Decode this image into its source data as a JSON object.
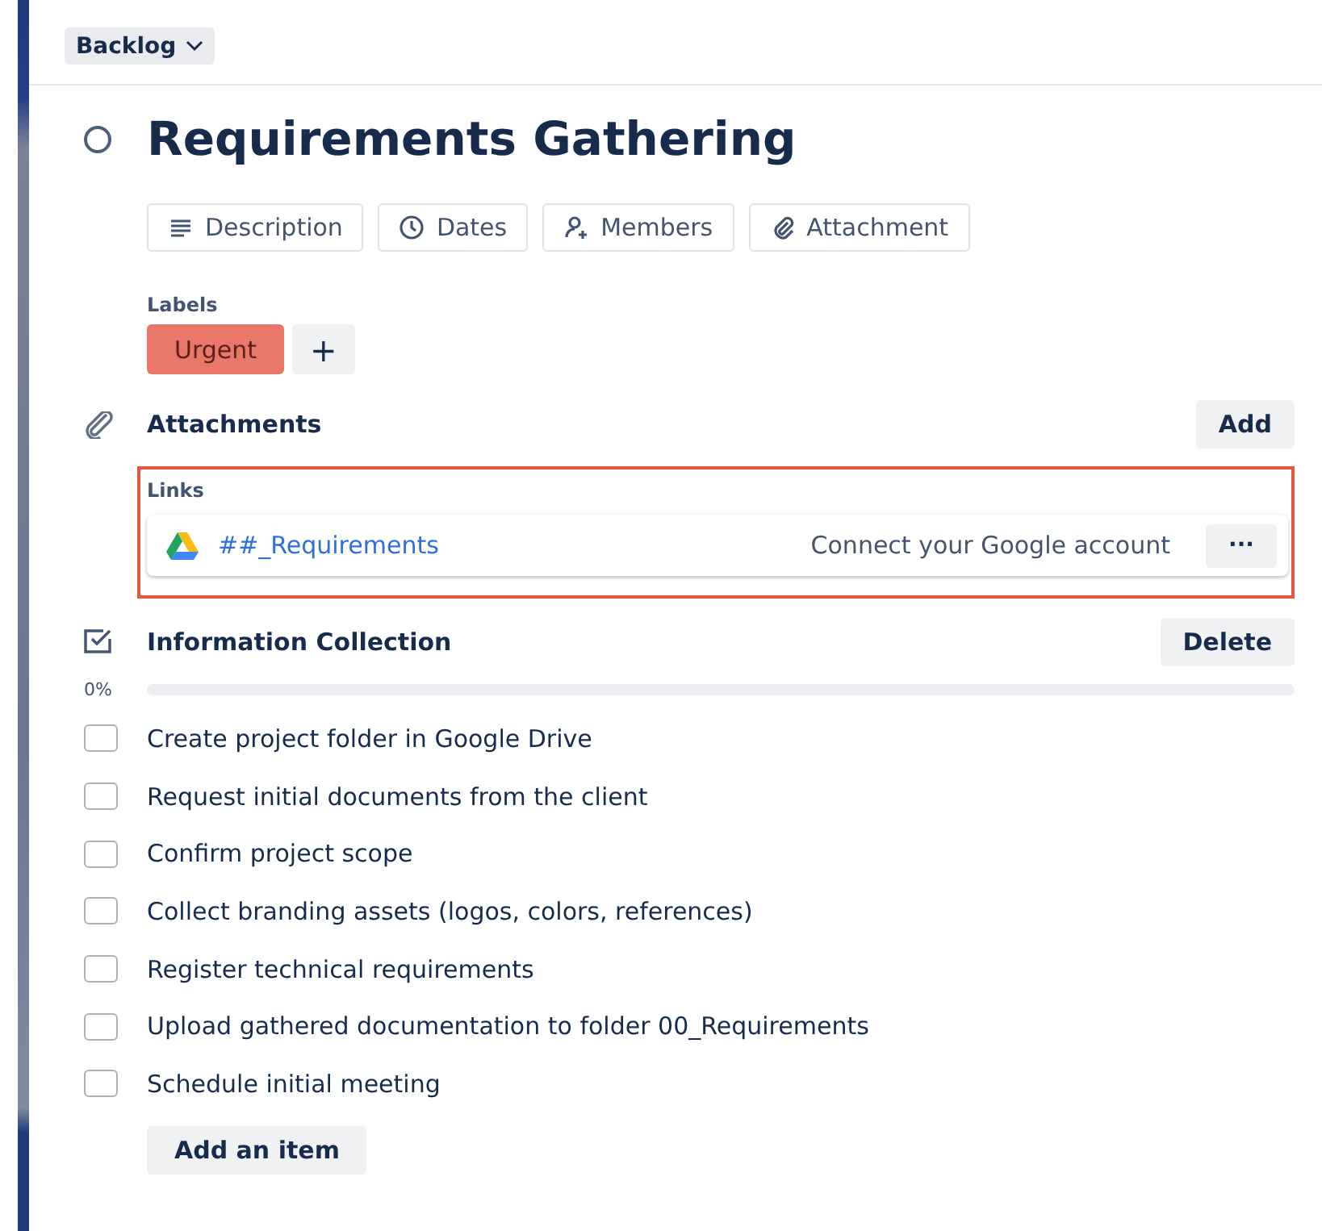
{
  "list_button": {
    "label": "Backlog"
  },
  "card": {
    "title": "Requirements Gathering",
    "completed": false
  },
  "actions": [
    {
      "label": "Description",
      "kind": "description"
    },
    {
      "label": "Dates",
      "kind": "dates"
    },
    {
      "label": "Members",
      "kind": "members"
    },
    {
      "label": "Attachment",
      "kind": "attachment"
    }
  ],
  "labels": {
    "heading": "Labels",
    "items": [
      {
        "text": "Urgent",
        "color": "#e9786b"
      }
    ],
    "add_symbol": "+"
  },
  "attachments": {
    "title": "Attachments",
    "add_button": "Add",
    "links_heading": "Links",
    "links": [
      {
        "name": "##_Requirements",
        "note": "Connect your Google account",
        "menu": "···"
      }
    ]
  },
  "checklist": {
    "title": "Information Collection",
    "delete_button": "Delete",
    "percent": "0%",
    "level": 0,
    "items": [
      {
        "text": "Create project folder in Google Drive",
        "checked": false
      },
      {
        "text": "Request initial documents from the client",
        "checked": false
      },
      {
        "text": "Confirm project scope",
        "checked": false
      },
      {
        "text": "Collect branding assets (logos, colors, references)",
        "checked": false
      },
      {
        "text": "Register technical requirements",
        "checked": false
      },
      {
        "text": "Upload gathered documentation to folder 00_Requirements",
        "checked": false
      },
      {
        "text": "Schedule initial meeting",
        "checked": false
      }
    ],
    "add_item": "Add an item"
  }
}
